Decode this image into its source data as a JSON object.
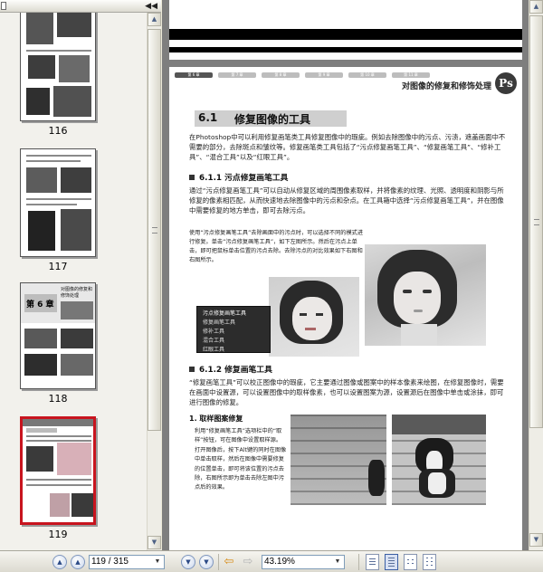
{
  "sidebar": {
    "thumbnails": [
      {
        "label": "116"
      },
      {
        "label": "117"
      },
      {
        "label": "118",
        "chapter": "第 6 章",
        "heading": "对图像的修复和修饰处理"
      },
      {
        "label": "119",
        "selected": true
      }
    ]
  },
  "page": {
    "header_tabs": [
      "第 6 章",
      "第 7 章",
      "第 8 章",
      "第 9 章",
      "第 10 章",
      "第 11 章"
    ],
    "header_title": "对图像的修复和修饰处理",
    "badge": "Ps",
    "section": {
      "number": "6.1",
      "title": "修复图像的工具"
    },
    "intro": "在Photoshop中可以利用修复画笔类工具修复图像中的瑕疵。例如去除图像中的污点、污渍，遮盖画面中不需要的部分，去除斑点和皱纹等。修复画笔类工具包括了“污点修复画笔工具”、“修复画笔工具”、“修补工具”、“混合工具”以及“红眼工具”。",
    "sub1": {
      "title": "6.1.1   污点修复画笔工具"
    },
    "para1": "通过“污点修复画笔工具”可以自动从修复区域的周围像素取样，并将像素的纹理、光照、透明度和阴影与所修复的像素相匹配，从而快速地去除图像中的污点和杂点。在工具箱中选择“污点修复画笔工具”，并在图像中需要修复的地方单击，即可去除污点。",
    "para1b": "使用“污点修复画笔工具”去除画面中的污点时，可以选择不同的模式进行修复。单击“污点修复画笔工具”，如下左图所示。然后在污点上单击，即可把鼠标单击位置的污点去除。去除污点的对比效果如下右图和右图所示。",
    "tool_menu": [
      "污点修复画笔工具",
      "修复画笔工具",
      "修补工具",
      "混合工具",
      "红眼工具"
    ],
    "sub2": {
      "title": "6.1.2   修复画笔工具"
    },
    "para2": "“修复画笔工具”可以校正图像中的瑕疵，它主要通过图像或图案中的样本像素来绘图，在修复图像时，需要在画面中设置源，可以设置图像中的取样像素，也可以设置图案为源，设置源后在图像中单击或涂抹，即可进行图像的修复。",
    "step1": "1. 取样图案修复",
    "para3": "利用“修复画笔工具”选项栏中的“取样”按钮，可在图像中设置取样源。打开图像后，按下Alt键的同时在图像中单击取样，然后在图像中需要修复的位置单击，即可将该位置的污点去除，右图所示即为单击去除左图中污点后的效果。"
  },
  "toolbar": {
    "page_display": "119 / 315",
    "zoom": "43.19%"
  },
  "icons": [
    "first-page-icon",
    "previous-page-icon",
    "next-page-icon",
    "last-page-icon",
    "go-back-icon",
    "go-forward-icon",
    "single-page-icon",
    "single-page-continuous-icon",
    "two-up-icon",
    "two-up-continuous-icon"
  ]
}
